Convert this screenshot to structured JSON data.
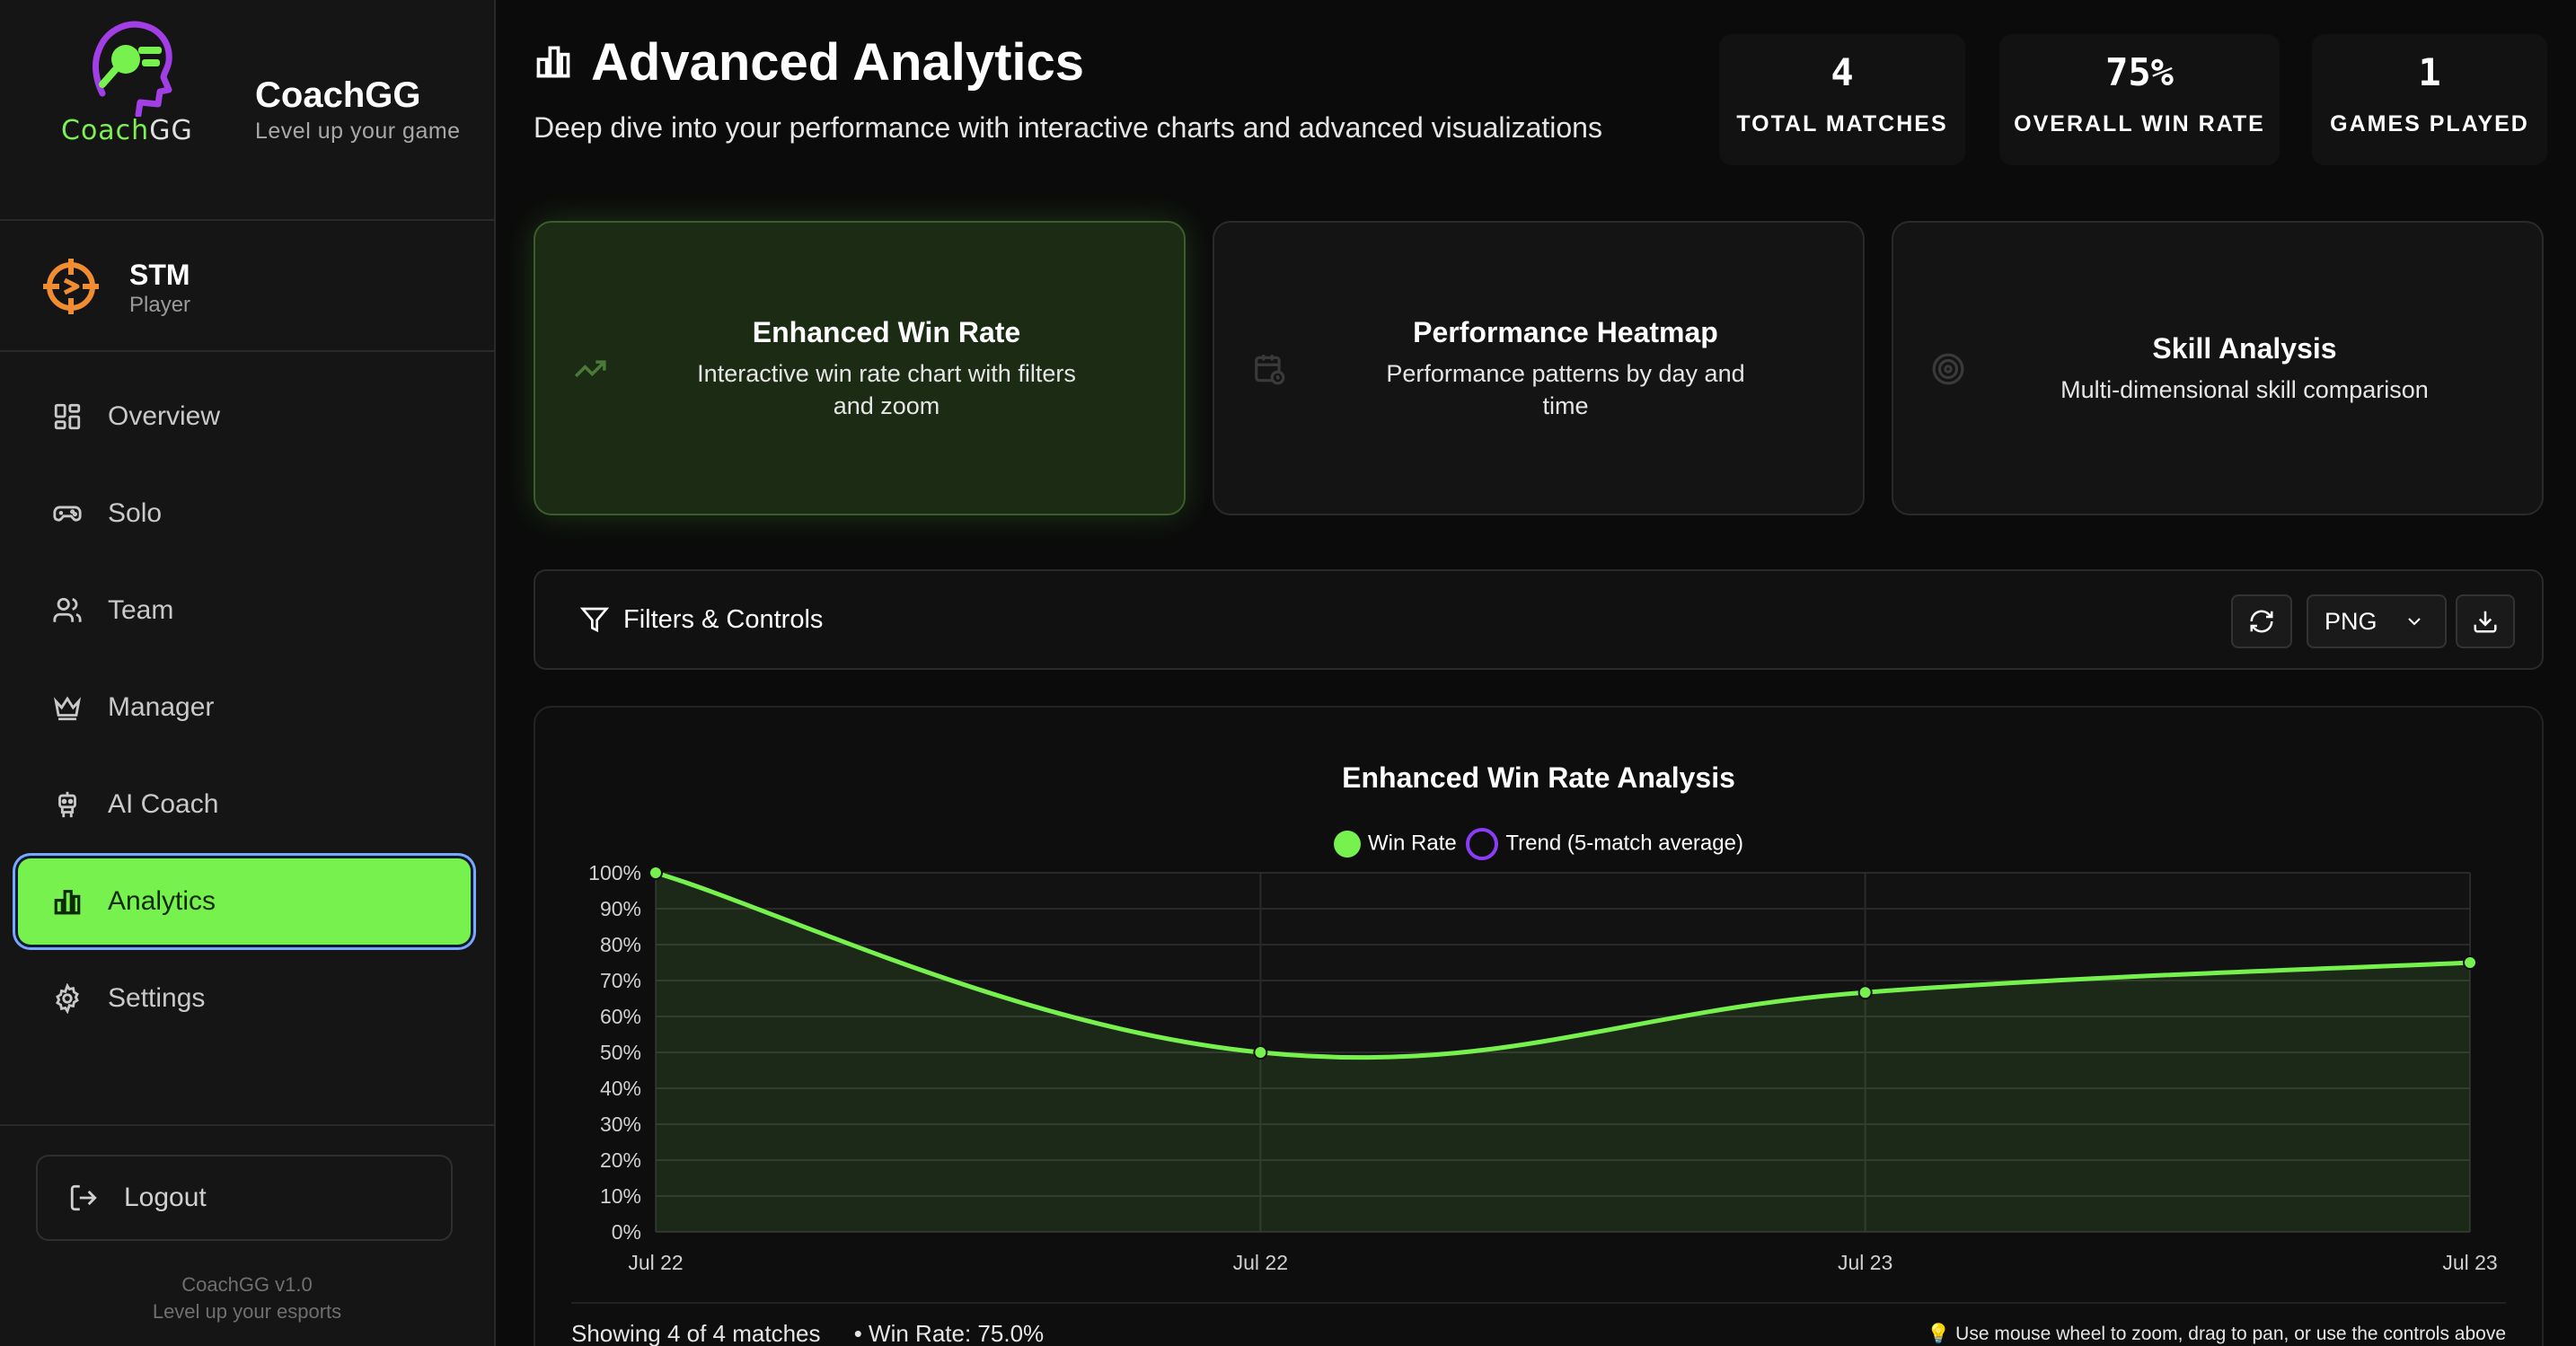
{
  "sidebar": {
    "logo_text_main": "Coach",
    "logo_text_accent": "GG",
    "brand_name": "CoachGG",
    "brand_tagline": "Level up your game",
    "user": {
      "name": "STM",
      "role": "Player"
    },
    "nav": [
      {
        "label": "Overview",
        "icon": "grid-icon"
      },
      {
        "label": "Solo",
        "icon": "gamepad-icon"
      },
      {
        "label": "Team",
        "icon": "users-icon"
      },
      {
        "label": "Manager",
        "icon": "crown-icon"
      },
      {
        "label": "AI Coach",
        "icon": "robot-icon"
      },
      {
        "label": "Analytics",
        "icon": "bar-chart-icon",
        "active": true
      },
      {
        "label": "Settings",
        "icon": "gear-icon"
      }
    ],
    "logout_label": "Logout",
    "version_line1": "CoachGG v1.0",
    "version_line2": "Level up your esports"
  },
  "header": {
    "title": "Advanced Analytics",
    "subtitle": "Deep dive into your performance with interactive charts and advanced visualizations",
    "stats": [
      {
        "value": "4",
        "label": "TOTAL MATCHES"
      },
      {
        "value": "75%",
        "label": "OVERALL WIN RATE"
      },
      {
        "value": "1",
        "label": "GAMES PLAYED"
      }
    ]
  },
  "cards": [
    {
      "title": "Enhanced Win Rate",
      "desc_line1": "Interactive win rate chart with filters",
      "desc_line2": "and zoom",
      "icon": "trending-up-icon",
      "active": true
    },
    {
      "title": "Performance Heatmap",
      "desc_line1": "Performance patterns by day and",
      "desc_line2": "time",
      "icon": "calendar-clock-icon"
    },
    {
      "title": "Skill Analysis",
      "desc_line1": "Multi-dimensional skill comparison",
      "icon": "target-icon"
    }
  ],
  "filters": {
    "label": "Filters & Controls",
    "format_value": "PNG"
  },
  "colors": {
    "accent": "#77f14e",
    "trend": "#8b3cf7",
    "background": "#0b0b0b"
  },
  "chart_data": {
    "type": "line",
    "title": "Enhanced Win Rate Analysis",
    "x": [
      "Jul 22",
      "Jul 22",
      "Jul 23",
      "Jul 23"
    ],
    "series": [
      {
        "name": "Win Rate",
        "values": [
          100,
          50,
          66.7,
          75
        ],
        "color": "#77f14e"
      },
      {
        "name": "Trend (5-match average)",
        "values": [],
        "color": "#8b3cf7"
      }
    ],
    "yticks": [
      "100%",
      "90%",
      "80%",
      "70%",
      "60%",
      "50%",
      "40%",
      "30%",
      "20%",
      "10%",
      "0%"
    ],
    "ylim": [
      0,
      100
    ],
    "grid": true,
    "legend": "top-center"
  },
  "chart_footer": {
    "showing": "Showing 4 of 4 matches",
    "win_rate": "• Win Rate: 75.0%",
    "hint": "💡 Use mouse wheel to zoom, drag to pan, or use the controls above"
  }
}
